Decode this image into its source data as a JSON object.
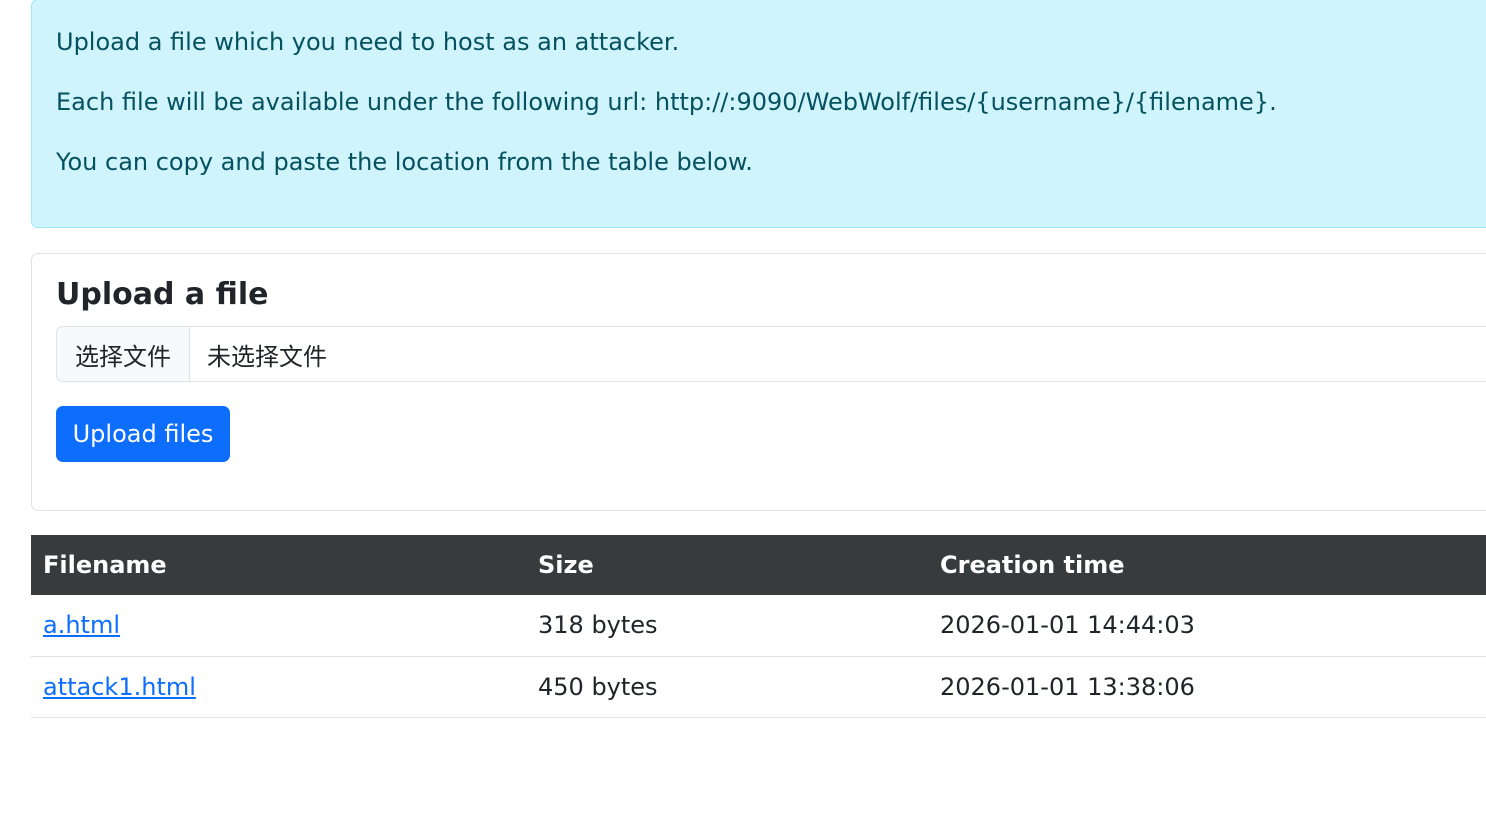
{
  "info": {
    "line1": "Upload a file which you need to host as an attacker.",
    "line2": "Each file will be available under the following url: http://:9090/WebWolf/files/{username}/{filename}.",
    "line3": "You can copy and paste the location from the table below."
  },
  "upload": {
    "title": "Upload a file",
    "choose_label": "选择文件",
    "no_file_label": "未选择文件",
    "submit_label": "Upload files"
  },
  "table": {
    "headers": [
      "Filename",
      "Size",
      "Creation time"
    ],
    "rows": [
      {
        "filename": "a.html",
        "size": "318 bytes",
        "created": "2026-01-01 14:44:03"
      },
      {
        "filename": "attack1.html",
        "size": "450 bytes",
        "created": "2026-01-01 13:38:06"
      }
    ]
  },
  "colors": {
    "alert_bg": "#cff4fc",
    "alert_text": "#055160",
    "primary": "#0d6efd",
    "table_header_bg": "#373b3e"
  }
}
